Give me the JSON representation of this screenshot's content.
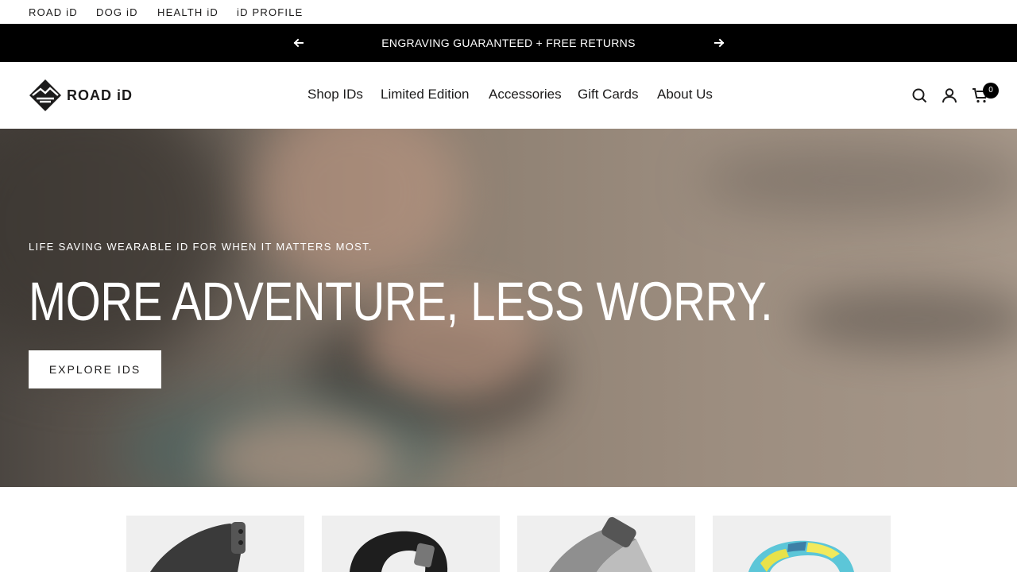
{
  "brand_bar": {
    "items": [
      "ROAD iD",
      "DOG iD",
      "HEALTH iD",
      "iD PROFILE"
    ]
  },
  "announcement": {
    "message": "ENGRAVING GUARANTEED + FREE RETURNS",
    "prev_icon": "arrow-left-icon",
    "next_icon": "arrow-right-icon"
  },
  "header": {
    "logo_text": "ROAD iD",
    "nav": [
      "Shop IDs",
      "Limited Edition",
      "Accessories",
      "Gift Cards",
      "About Us"
    ],
    "cart_count": "0",
    "icons": [
      "search-icon",
      "account-icon",
      "cart-icon"
    ]
  },
  "hero": {
    "tagline": "LIFE SAVING WEARABLE ID FOR WHEN IT MATTERS MOST.",
    "title": "MORE ADVENTURE, LESS WORRY.",
    "cta": "EXPLORE IDS"
  },
  "colors": {
    "announcement_bg": "#000000",
    "text": "#1c1b1b",
    "card_bg": "#efefef"
  }
}
